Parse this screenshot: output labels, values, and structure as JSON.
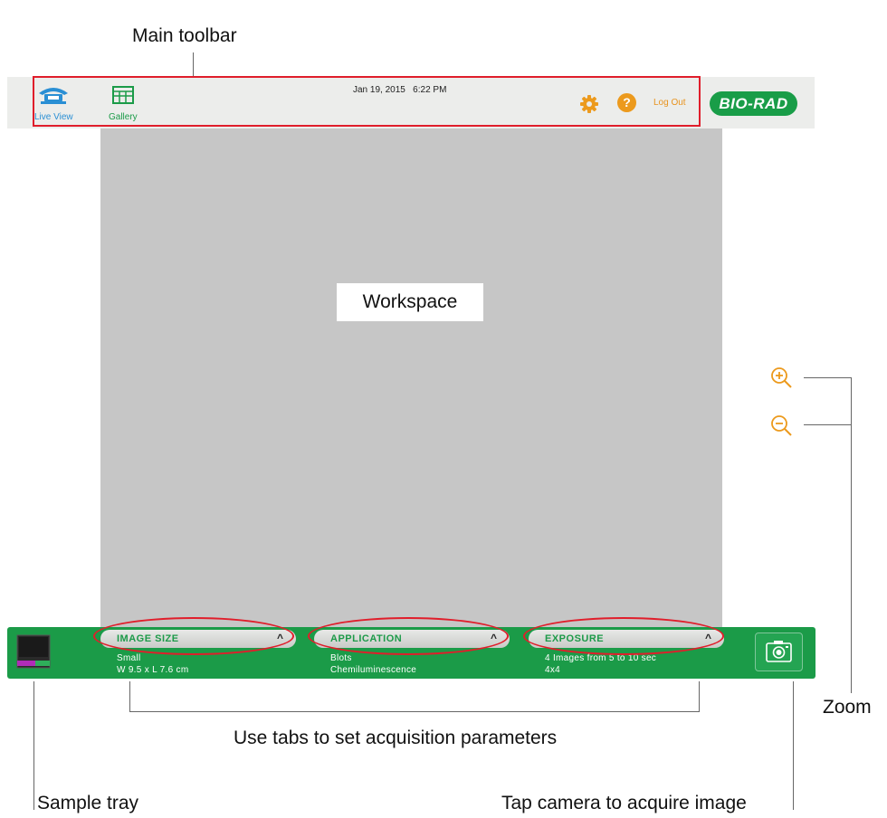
{
  "annotations": {
    "main_toolbar": "Main toolbar",
    "workspace": "Workspace",
    "zoom": "Zoom",
    "tabs": "Use tabs to set acquisition parameters",
    "sample_tray": "Sample tray",
    "camera": "Tap camera to acquire image"
  },
  "toolbar": {
    "live_view_label": "Live View",
    "gallery_label": "Gallery",
    "date": "Jan 19, 2015",
    "time": "6:22 PM",
    "logout_label": "Log Out",
    "help_glyph": "?",
    "logo_text": "BIO-RAD"
  },
  "tabs": [
    {
      "title": "IMAGE SIZE",
      "line1": "Small",
      "line2": "W 9.5 x L 7.6 cm"
    },
    {
      "title": "APPLICATION",
      "line1": "Blots",
      "line2": "Chemiluminescence"
    },
    {
      "title": "EXPOSURE",
      "line1": "4 Images from 5 to 10 sec",
      "line2": "4x4"
    }
  ],
  "icons": {
    "live_view": "live-view-icon",
    "gallery": "gallery-icon",
    "settings": "gear-icon",
    "help": "help-icon",
    "zoom_in": "zoom-in-icon",
    "zoom_out": "zoom-out-icon",
    "camera": "camera-icon",
    "sample_tray": "sample-tray-icon"
  },
  "colors": {
    "brand_green": "#1b9b48",
    "accent_orange": "#ec9a1d",
    "live_view_blue": "#2a8fd4",
    "highlight_red": "#e01e2b",
    "workspace_gray": "#c6c6c6"
  }
}
